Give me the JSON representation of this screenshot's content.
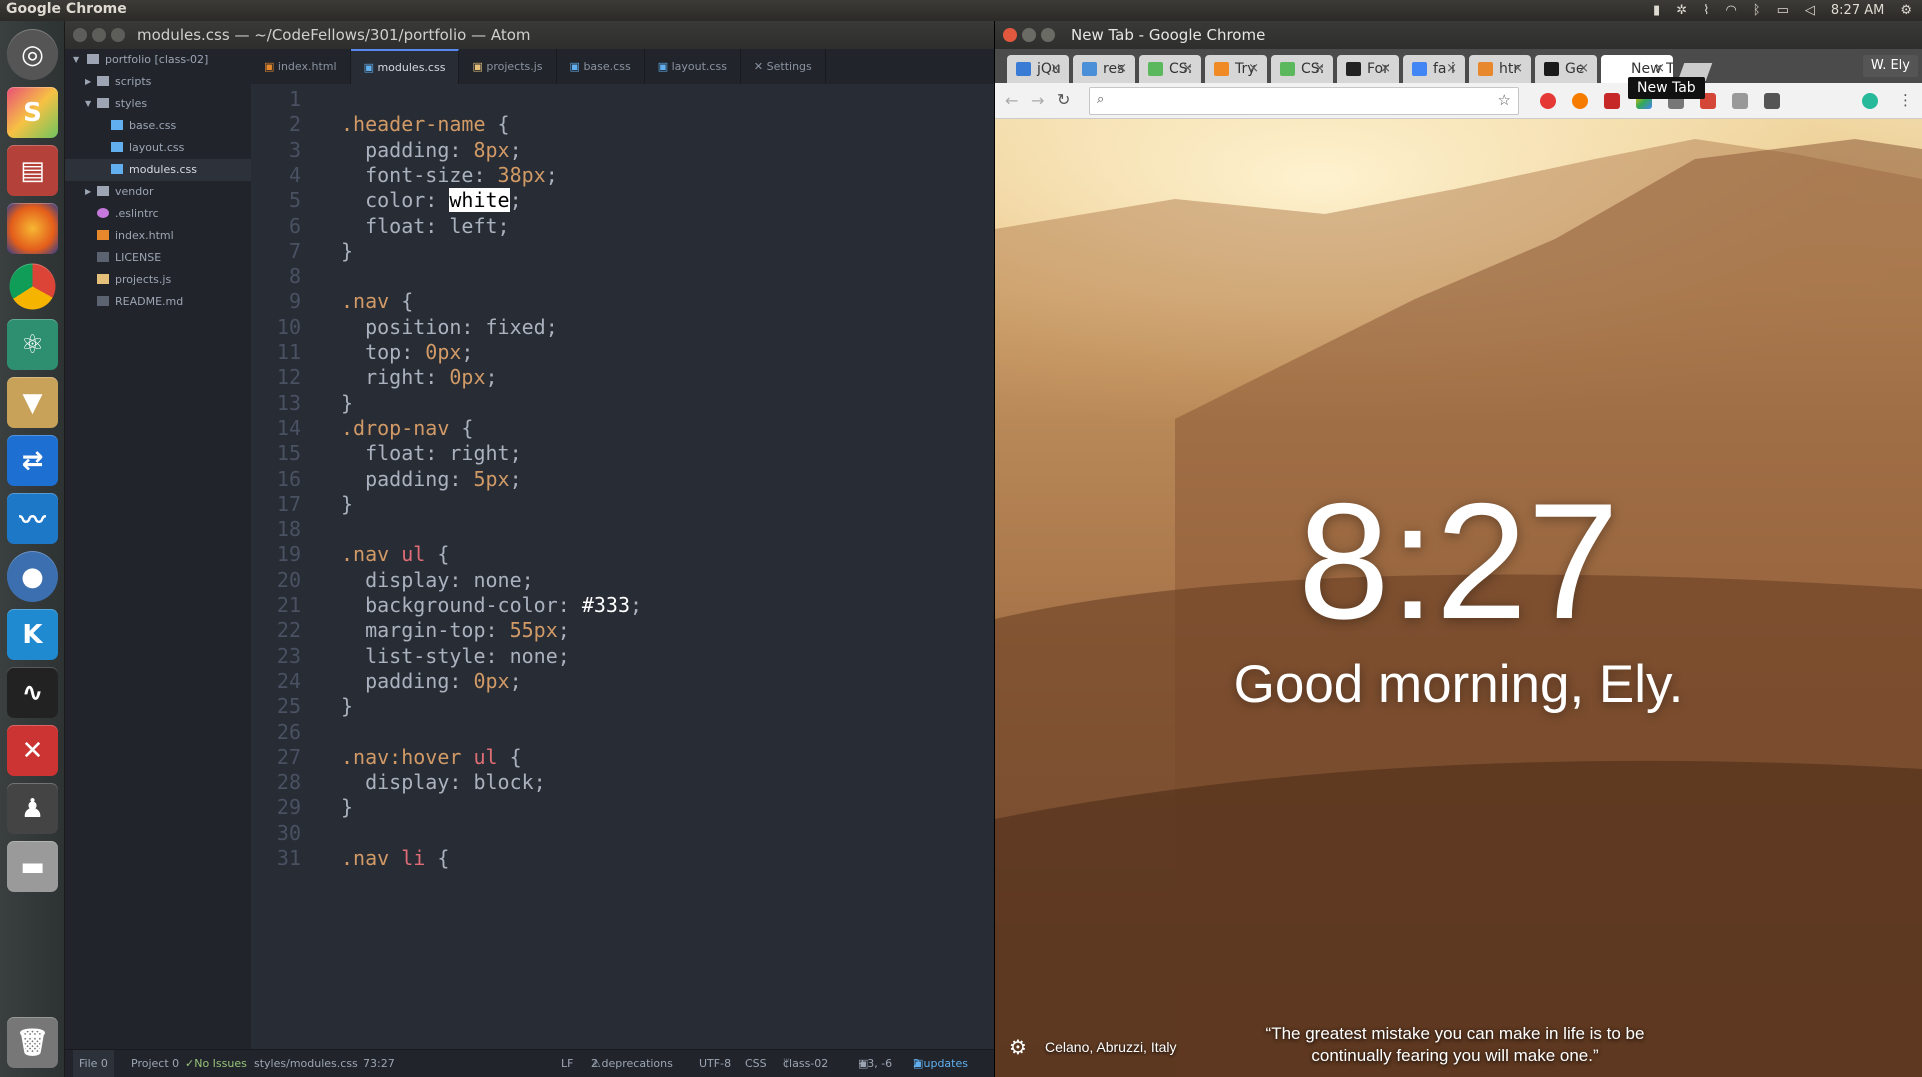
{
  "system": {
    "app_name": "Google Chrome",
    "clock": "8:27 AM"
  },
  "atom": {
    "title": "modules.css — ~/CodeFellows/301/portfolio — Atom",
    "tree": [
      {
        "label": "portfolio [class-02]",
        "type": "project"
      },
      {
        "label": "scripts",
        "type": "folder"
      },
      {
        "label": "styles",
        "type": "folder-open"
      },
      {
        "label": "base.css",
        "type": "css"
      },
      {
        "label": "layout.css",
        "type": "css"
      },
      {
        "label": "modules.css",
        "type": "css",
        "selected": true
      },
      {
        "label": "vendor",
        "type": "folder"
      },
      {
        "label": ".eslintrc",
        "type": "config"
      },
      {
        "label": "index.html",
        "type": "html"
      },
      {
        "label": "LICENSE",
        "type": "text"
      },
      {
        "label": "projects.js",
        "type": "js"
      },
      {
        "label": "README.md",
        "type": "text"
      }
    ],
    "tabs": [
      "index.html",
      "modules.css",
      "projects.js",
      "base.css",
      "layout.css",
      "Settings"
    ],
    "active_tab": "modules.css",
    "code_lines": [
      "",
      ".header-name {",
      "  padding: 8px;",
      "  font-size: 38px;",
      "  color: white;",
      "  float: left;",
      "}",
      "",
      ".nav {",
      "  position: fixed;",
      "  top: 0px;",
      "  right: 0px;",
      "}",
      ".drop-nav {",
      "  float: right;",
      "  padding: 5px;",
      "}",
      "",
      ".nav ul {",
      "  display: none;",
      "  background-color: #333;",
      "  margin-top: 55px;",
      "  list-style: none;",
      "  padding: 0px;",
      "}",
      "",
      ".nav:hover ul {",
      "  display: block;",
      "}",
      "",
      ".nav li {"
    ],
    "status": {
      "file": "File 0",
      "project": "Project 0",
      "issues": "No Issues",
      "path": "styles/modules.css",
      "cursor": "73:27",
      "line_ending": "LF",
      "deprecations": "2 deprecations",
      "encoding": "UTF-8",
      "grammar": "CSS",
      "branch": "class-02",
      "git_diff": "+3, -6",
      "updates": "2 updates"
    }
  },
  "chrome": {
    "title": "New Tab - Google Chrome",
    "tabs": [
      {
        "label": "jQu",
        "color": "#3a7bd5"
      },
      {
        "label": "res",
        "color": "#4a90d9"
      },
      {
        "label": "CS:",
        "color": "#5cb85c"
      },
      {
        "label": "Try",
        "color": "#f08a24"
      },
      {
        "label": "CS:",
        "color": "#5cb85c"
      },
      {
        "label": "For",
        "color": "#222222"
      },
      {
        "label": "fa i",
        "color": "#4285f4"
      },
      {
        "label": "htr",
        "color": "#e8882c"
      },
      {
        "label": "Ge",
        "color": "#1a1a1a"
      },
      {
        "label": "New T",
        "color": "#ffffff"
      }
    ],
    "user": "W. Ely",
    "tooltip": "New Tab",
    "ntp": {
      "time": "8:27",
      "greeting": "Good morning, Ely.",
      "location": "Celano, Abruzzi, Italy",
      "quote_line1": "“The greatest mistake you can make in life is to be",
      "quote_line2": "continually fearing you will make one.”"
    }
  }
}
